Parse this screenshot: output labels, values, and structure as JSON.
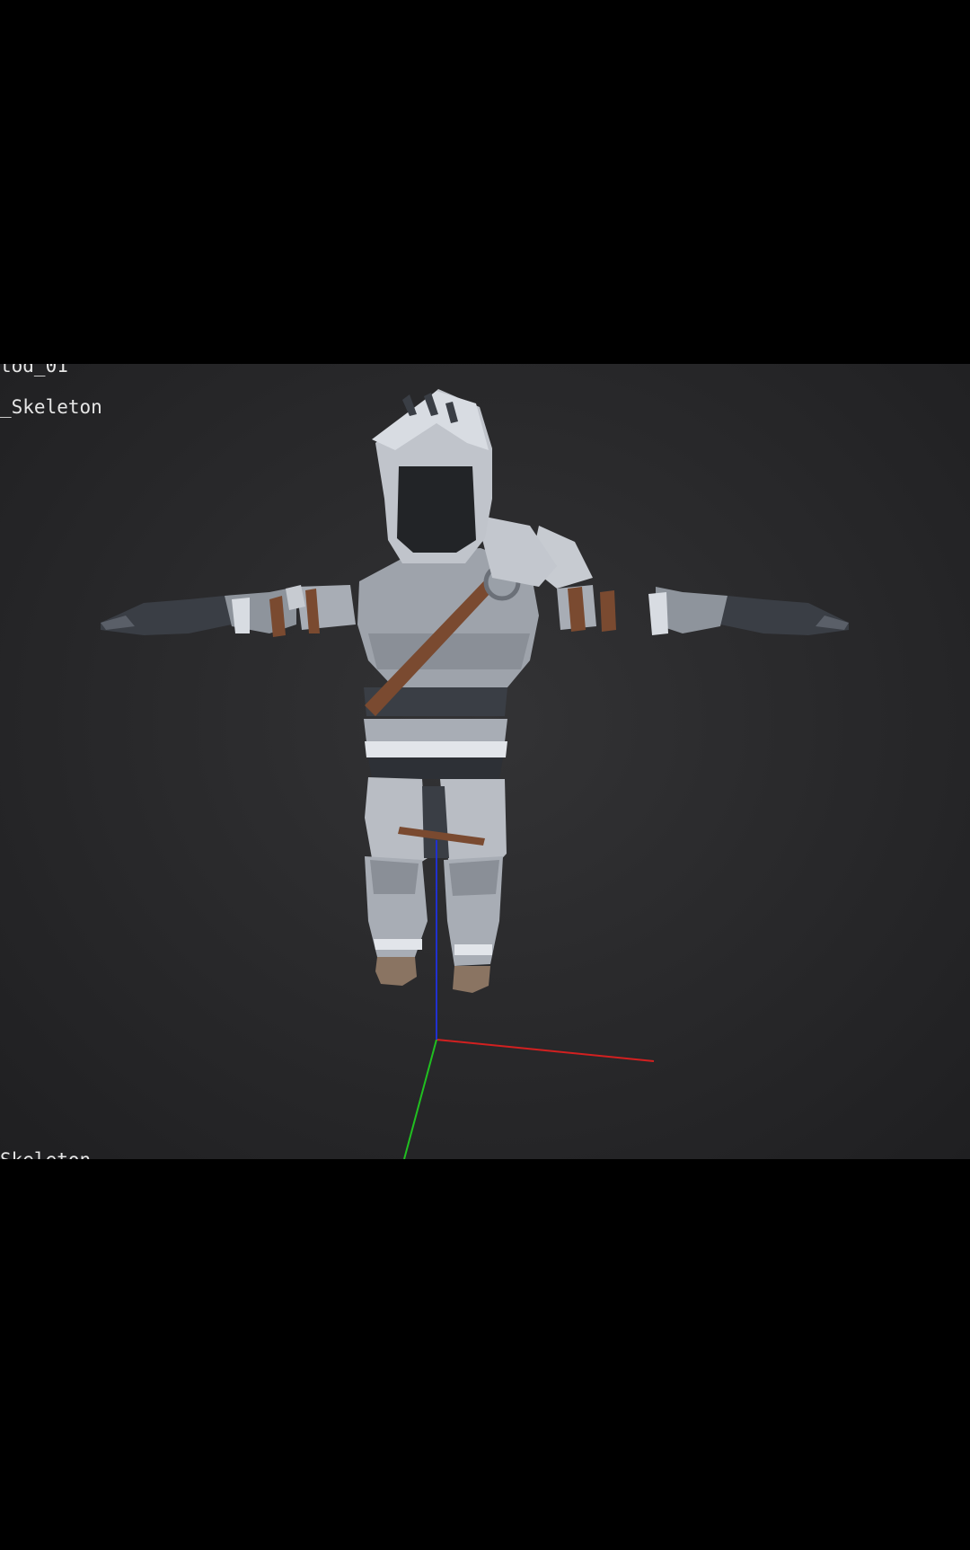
{
  "viewport": {
    "labels": {
      "top_cut": "tod_01",
      "skeleton": "_Skeleton",
      "bottom_cut": "Skeleton"
    },
    "axis_gizmo": {
      "x_color": "#d22020",
      "y_color": "#20c020",
      "z_color": "#2030d0"
    },
    "model": {
      "name": "armored-knight",
      "pose": "T-pose",
      "armor_color": "#b9bdc4",
      "dark_color": "#3a3e45",
      "strap_color": "#7a4a30"
    }
  }
}
